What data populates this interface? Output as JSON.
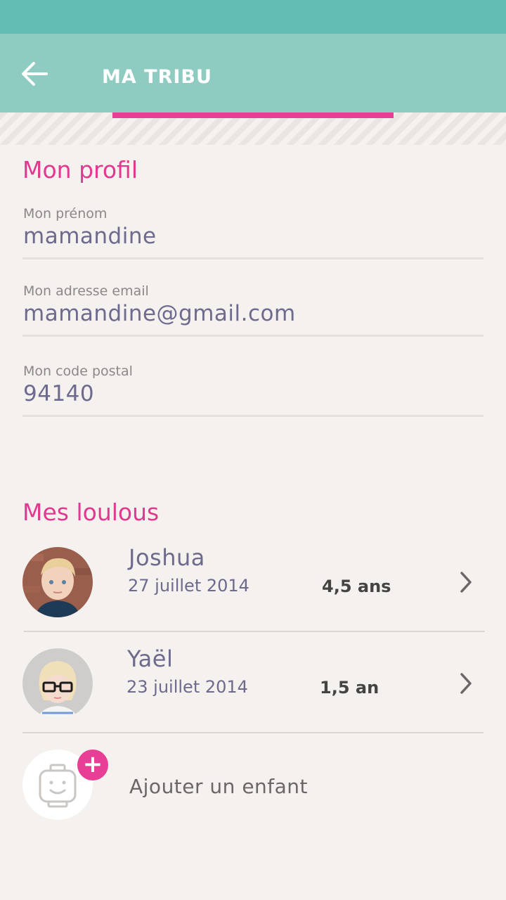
{
  "app_bar": {
    "title": "MA TRIBU"
  },
  "profile": {
    "section_title": "Mon profil",
    "fields": [
      {
        "label": "Mon prénom",
        "value": "mamandine"
      },
      {
        "label": "Mon adresse email",
        "value": "mamandine@gmail.com"
      },
      {
        "label": "Mon code postal",
        "value": "94140"
      }
    ]
  },
  "children": {
    "section_title": "Mes loulous",
    "items": [
      {
        "name": "Joshua",
        "birthdate": "27 juillet 2014",
        "age": "4,5 ans"
      },
      {
        "name": "Yaël",
        "birthdate": "23 juillet 2014",
        "age": "1,5 an"
      }
    ],
    "add_label": "Ajouter un enfant",
    "add_badge": "+"
  },
  "colors": {
    "status_bar": "#62bcb4",
    "app_bar": "#8ecbc0",
    "accent": "#e83e95",
    "text_primary": "#6e6a8e",
    "background": "#f4f1ee"
  },
  "icons": {
    "back": "arrow-left-icon",
    "chevron": "chevron-right-icon",
    "add_child": "child-face-icon"
  }
}
